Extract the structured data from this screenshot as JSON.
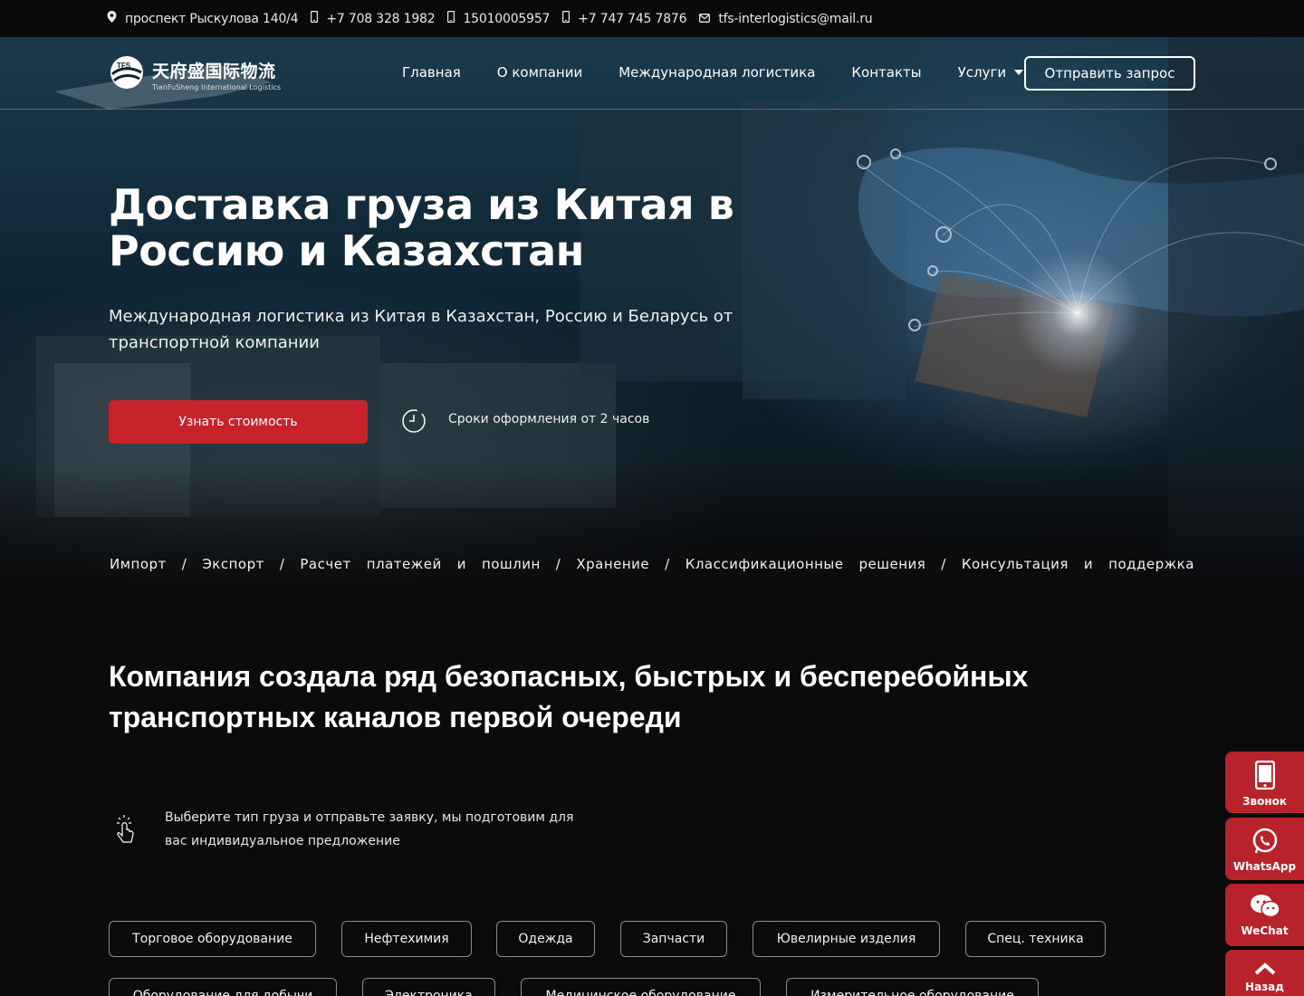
{
  "topbar": {
    "address": "проспект Рыскулова 140/4",
    "phone1": "+7 708 328 1982",
    "phone2": "15010005957",
    "phone3": "+7 747 745 7876",
    "email": "tfs-interlogistics@mail.ru"
  },
  "logo": {
    "badge": "TFS",
    "cn": "天府盛国际物流",
    "en": "TianFuSheng International Logistics"
  },
  "nav": {
    "items": [
      "Главная",
      "О компании",
      "Международная логистика",
      "Контакты",
      "Услуги"
    ],
    "cta": "Отправить запрос"
  },
  "hero": {
    "title": "Доставка груза из Китая в Россию и Казахстан",
    "subtitle": "Международная логистика из Китая в Казахстан, Россию и Беларусь от транспортной компании",
    "button": "Узнать стоимость",
    "timing": "Сроки оформления от 2 часов",
    "services": [
      "Импорт",
      "/",
      "Экспорт",
      "/",
      "Расчет",
      "платежей",
      "и",
      "пошлин",
      "/",
      "Хранение",
      "/",
      "Классификационные",
      "решения",
      "/",
      "Консультация",
      "и",
      "поддержка"
    ]
  },
  "section": {
    "title": "Компания создала ряд безопасных, быстрых и бесперебойных транспортных каналов первой очереди",
    "hint": "Выберите тип груза и отправьте заявку, мы подготовим для вас индивидуальное предложение",
    "chips_row1": [
      "Торговое оборудование",
      "Нефтехимия",
      "Одежда",
      "Запчасти",
      "Ювелирные изделия",
      "Спец. техника"
    ],
    "chips_row2": [
      "Оборудование для добычи",
      "Электроника",
      "Медицинское оборудование",
      "Измерительное оборудование"
    ]
  },
  "widgets": {
    "call": "Звонок",
    "whatsapp": "WhatsApp",
    "wechat": "WeChat",
    "back": "Назад"
  },
  "colors": {
    "accent_red": "#c8222b",
    "widget_red": "#b8232b",
    "background": "#0b0b0c"
  }
}
